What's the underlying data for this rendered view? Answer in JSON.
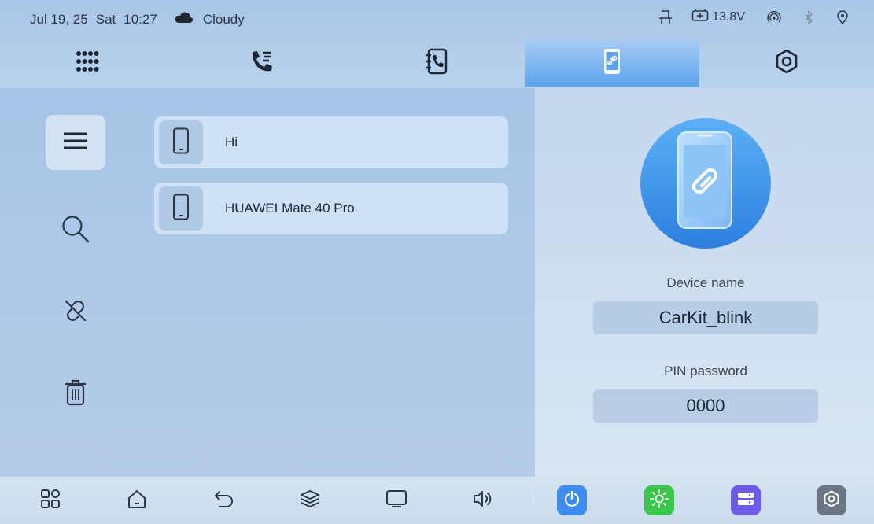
{
  "status_bar": {
    "date": "Jul 19, 25",
    "weekday": "Sat",
    "time": "10:27",
    "weather": "Cloudy",
    "voltage": "13.8V",
    "icons": [
      "cloud-icon",
      "seat-icon",
      "battery-icon",
      "signal-icon",
      "bluetooth-icon",
      "location-icon"
    ]
  },
  "top_tabs": [
    {
      "name": "apps",
      "icon": "grid-dots-icon"
    },
    {
      "name": "recent-calls",
      "icon": "call-log-icon"
    },
    {
      "name": "contacts",
      "icon": "contacts-icon"
    },
    {
      "name": "phone-link",
      "icon": "phone-link-icon",
      "active": true
    },
    {
      "name": "settings",
      "icon": "settings-icon"
    }
  ],
  "devices": [
    {
      "name": "Hi"
    },
    {
      "name": "HUAWEI Mate 40 Pro"
    }
  ],
  "device_info": {
    "device_name_label": "Device name",
    "device_name_value": "CarKit_blink",
    "pin_label": "PIN password",
    "pin_value": "0000"
  },
  "colors": {
    "accent": "#3b8ee8",
    "power_tile": "#3d8df0",
    "brightness_tile": "#39c64a",
    "storage_tile": "#6b5be8",
    "settings_tile": "#6b7584"
  }
}
